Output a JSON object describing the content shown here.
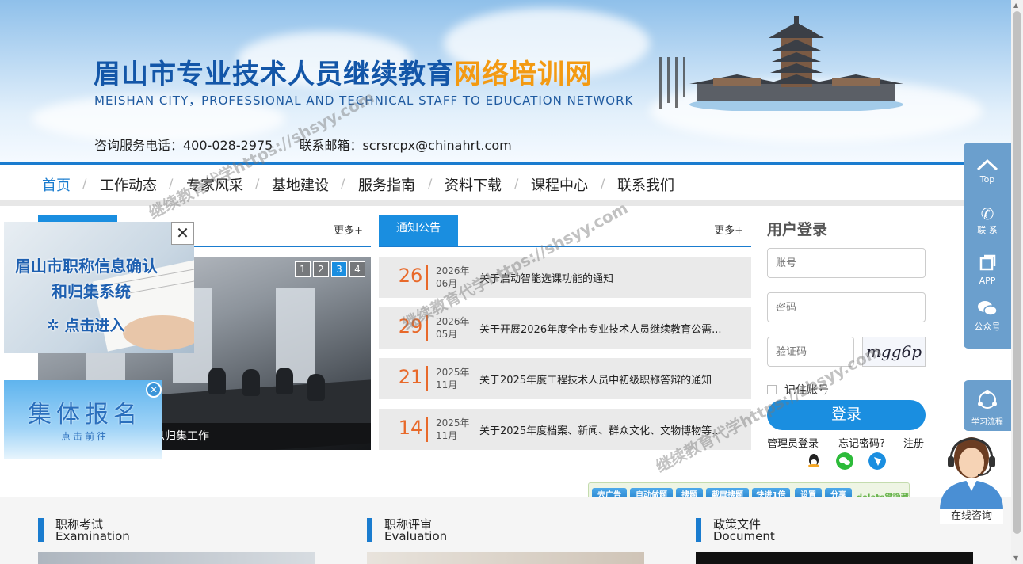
{
  "header": {
    "title_main": "眉山市专业技术人员继续教育",
    "title_highlight": "网络培训网",
    "subtitle": "MEISHAN CITY，PROFESSIONAL AND TECHNICAL STAFF TO EDUCATION NETWORK",
    "phone": "咨询服务电话：400-028-2975",
    "email": "联系邮箱：scrsrcpx@chinahrt.com"
  },
  "nav": {
    "items": [
      "首页",
      "工作动态",
      "专家风采",
      "基地建设",
      "服务指南",
      "资料下载",
      "课程中心",
      "联系我们"
    ]
  },
  "news": {
    "more": "更多+",
    "caption": "专业技术人才职称信息归集工作",
    "pages": [
      "1",
      "2",
      "3",
      "4"
    ]
  },
  "notices": {
    "tab": "通知公告",
    "more": "更多+",
    "items": [
      {
        "day": "26",
        "year": "2026年",
        "month": "06月",
        "text": "关于启动智能选课功能的通知"
      },
      {
        "day": "29",
        "year": "2026年",
        "month": "05月",
        "text": "关于开展2026年度全市专业技术人员继续教育公需..."
      },
      {
        "day": "21",
        "year": "2025年",
        "month": "11月",
        "text": "关于2025年度工程技术人员中初级职称答辩的通知"
      },
      {
        "day": "14",
        "year": "2025年",
        "month": "11月",
        "text": "关于2025年度档案、新闻、群众文化、文物博物等..."
      }
    ]
  },
  "login": {
    "title": "用户登录",
    "account_placeholder": "账号",
    "password_placeholder": "密码",
    "captcha_placeholder": "验证码",
    "captcha_text": "mgg6p",
    "remember": "记住账号",
    "button": "登录",
    "admin": "管理员登录",
    "forgot": "忘记密码?",
    "register": "注册"
  },
  "side": {
    "top": "Top",
    "contact": "联 系",
    "app": "APP",
    "wechat": "公众号",
    "flow": "学习流程"
  },
  "popups": {
    "title_line1": "眉山市职称信息确认",
    "title_line2": "和归集系统",
    "enter": "点击进入",
    "group": "集体报名",
    "go": "点击前往"
  },
  "toolbar": {
    "buttons": [
      "去广告",
      "自动做题",
      "搜题",
      "截屏搜题",
      "快进1倍",
      "设置",
      "分享"
    ],
    "hint": "delete键隐藏"
  },
  "sections": [
    {
      "cn": "职称考试",
      "en": "Examination"
    },
    {
      "cn": "职称评审",
      "en": "Evaluation"
    },
    {
      "cn": "政策文件",
      "en": "Document"
    }
  ],
  "service": {
    "label": "在线咨询"
  },
  "watermark": "继续教育代学https://shsyy.com",
  "colors": {
    "primary": "#1a7ccf",
    "accent": "#f39a12",
    "date": "#e8692a",
    "side": "#6b9fcd"
  }
}
